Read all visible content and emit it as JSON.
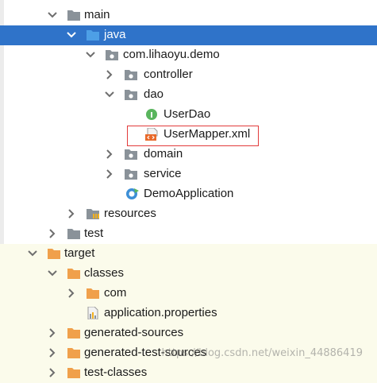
{
  "colors": {
    "selection": "#2f73c9",
    "target_band": "#fbfbeb",
    "folder_gray": "#8a9299",
    "folder_blue": "#4d9fe6",
    "folder_orange": "#f0a04b",
    "highlight": "#e23b3b"
  },
  "tree": {
    "rows": [
      {
        "label": "main",
        "chevron": "down",
        "icon": "folder-gray-icon"
      },
      {
        "label": "java",
        "chevron": "down",
        "icon": "folder-blue-icon",
        "selected": true
      },
      {
        "label": "com.lihaoyu.demo",
        "chevron": "down",
        "icon": "package-icon"
      },
      {
        "label": "controller",
        "chevron": "right",
        "icon": "package-icon"
      },
      {
        "label": "dao",
        "chevron": "down",
        "icon": "package-icon"
      },
      {
        "label": "UserDao",
        "chevron": "none",
        "icon": "interface-icon"
      },
      {
        "label": "UserMapper.xml",
        "chevron": "none",
        "icon": "xml-file-icon",
        "highlighted": true
      },
      {
        "label": "domain",
        "chevron": "right",
        "icon": "package-icon"
      },
      {
        "label": "service",
        "chevron": "right",
        "icon": "package-icon"
      },
      {
        "label": "DemoApplication",
        "chevron": "none",
        "icon": "spring-app-icon"
      },
      {
        "label": "resources",
        "chevron": "right",
        "icon": "resources-folder-icon"
      },
      {
        "label": "test",
        "chevron": "right",
        "icon": "folder-gray-icon"
      },
      {
        "label": "target",
        "chevron": "down",
        "icon": "folder-orange-icon"
      },
      {
        "label": "classes",
        "chevron": "down",
        "icon": "folder-orange-icon"
      },
      {
        "label": "com",
        "chevron": "right",
        "icon": "folder-orange-icon"
      },
      {
        "label": "application.properties",
        "chevron": "none",
        "icon": "properties-file-icon"
      },
      {
        "label": "generated-sources",
        "chevron": "right",
        "icon": "folder-orange-icon"
      },
      {
        "label": "generated-test-sources",
        "chevron": "right",
        "icon": "folder-orange-icon"
      },
      {
        "label": "test-classes",
        "chevron": "right",
        "icon": "folder-orange-icon"
      }
    ]
  },
  "watermark": "https://blog.csdn.net/weixin_44886419"
}
